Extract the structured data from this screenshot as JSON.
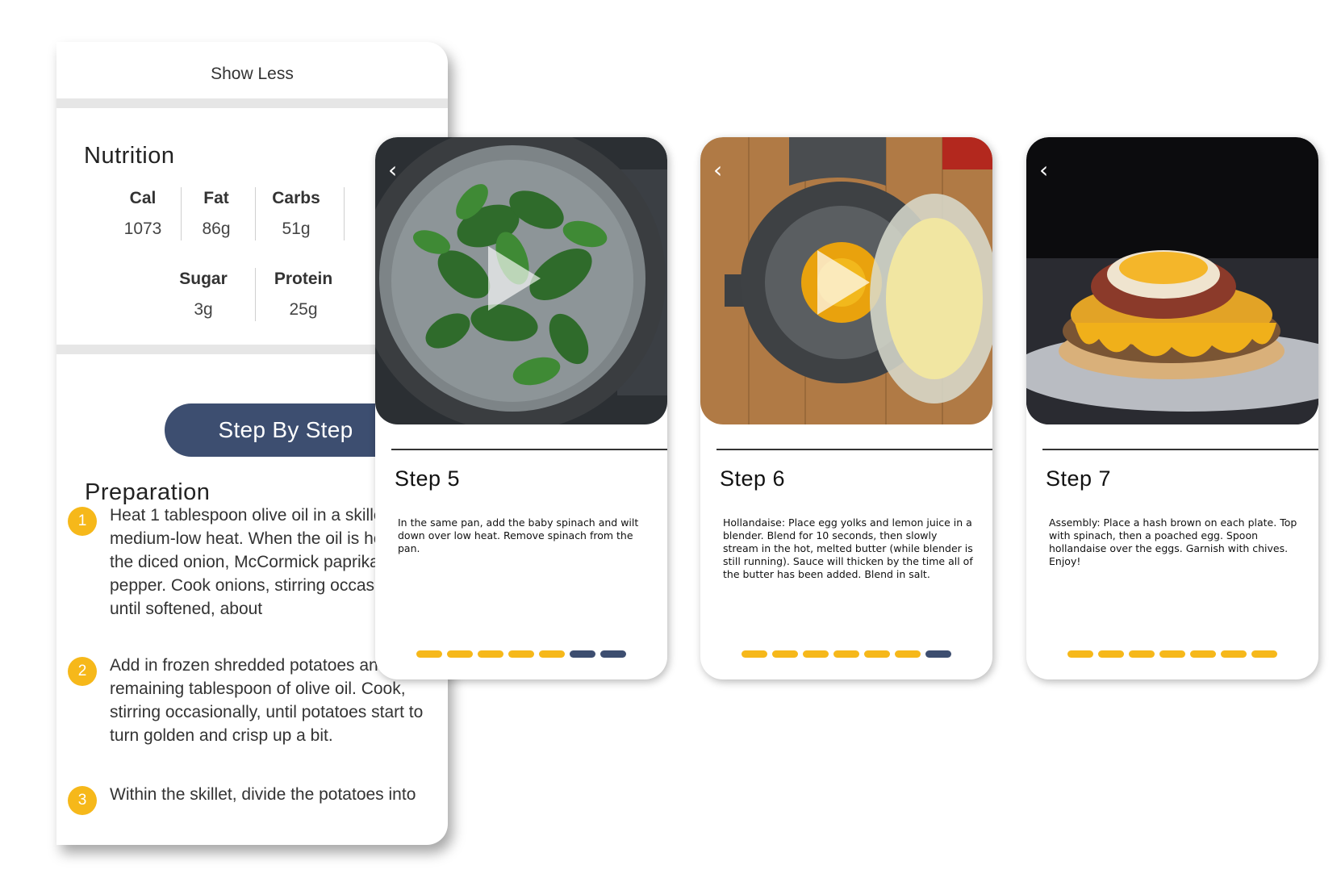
{
  "recipe": {
    "show_less": "Show Less",
    "nutrition": {
      "title": "Nutrition",
      "stats": [
        {
          "label": "Cal",
          "value": "1073"
        },
        {
          "label": "Fat",
          "value": "86g"
        },
        {
          "label": "Carbs",
          "value": "51g"
        },
        {
          "label": "Sugar",
          "value": "3g"
        },
        {
          "label": "Protein",
          "value": "25g"
        }
      ]
    },
    "step_by_step_label": "Step By Step",
    "preparation": {
      "title": "Preparation",
      "steps": [
        {
          "num": "1",
          "text": "Heat 1 tablespoon olive oil in a skillet over medium-low heat. When the oil is hot, add the diced onion, McCormick paprika, salt and pepper. Cook onions, stirring occasionally, until softened, about"
        },
        {
          "num": "2",
          "text": "Add in frozen shredded potatoes and the remaining tablespoon of olive oil. Cook, stirring occasionally, until potatoes start to turn golden and crisp up a bit."
        },
        {
          "num": "3",
          "text": "Within the skillet, divide the potatoes into"
        }
      ]
    }
  },
  "step_cards": [
    {
      "title": "Step 5",
      "description": "In the same pan, add the baby spinach and wilt down over low heat. Remove spinach from the pan.",
      "progress_complete": 5,
      "progress_total": 7
    },
    {
      "title": "Step 6",
      "description": "Hollandaise: Place egg yolks and lemon juice in a blender. Blend for 10 seconds, then slowly stream in the hot, melted butter (while blender is still running). Sauce will thicken by the time all of the butter has been added. Blend in salt.",
      "progress_complete": 6,
      "progress_total": 7
    },
    {
      "title": "Step 7",
      "description": "Assembly: Place a hash brown on each plate. Top with spinach, then a poached egg. Spoon hollandaise over the eggs. Garnish with chives. Enjoy!",
      "progress_complete": 7,
      "progress_total": 7
    }
  ],
  "colors": {
    "accent": "#f6b81a",
    "primary": "#3d4e70",
    "divider": "#e6e6e6"
  }
}
